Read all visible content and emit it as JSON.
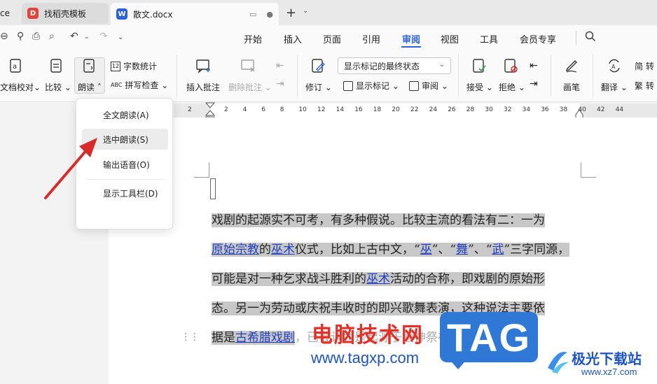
{
  "colors": {
    "accent": "#2b62d9",
    "selection": "#c8c8c8",
    "link": "#1f3fbf",
    "arrow": "#d62c2c"
  },
  "tabs": [
    {
      "label": "ce"
    },
    {
      "label": "找稻壳模板",
      "icon": "docer-icon"
    },
    {
      "label": "散文.docx",
      "icon": "word-doc-icon"
    }
  ],
  "menu": [
    "开始",
    "插入",
    "页面",
    "引用",
    "审阅",
    "视图",
    "工具",
    "会员专享"
  ],
  "menu_active": "审阅",
  "ribbon": {
    "doc_check": "文档校对",
    "compare": "比较",
    "read_aloud": "朗读",
    "word_count": "字数统计",
    "spell_check": "拼写检查",
    "insert_comment": "插入批注",
    "delete_comment": "删除批注",
    "revise": "修订",
    "show_markup_final": "显示标记的最终状态",
    "show_markup": "显示标记",
    "review": "审阅",
    "accept": "接受",
    "reject": "拒绝",
    "pen": "画笔",
    "translate": "翻译",
    "convert_simplified": "简 转",
    "convert_traditional": "繁 转"
  },
  "ruler_ticks": [
    "2",
    "2",
    "4",
    "6",
    "8",
    "10",
    "12",
    "14",
    "16",
    "18",
    "20",
    "22",
    "24",
    "26",
    "28",
    "30",
    "32",
    "34",
    "36",
    "38",
    "40",
    "42",
    "44"
  ],
  "popup": {
    "items": [
      "全文朗读(A)",
      "选中朗读(S)",
      "输出语音(O)",
      "显示工具栏(D)"
    ],
    "hovered_index": 1
  },
  "document": {
    "line1": "戏剧的起源实不可考，有多种假说。比较主流的看法有二：一为",
    "line2_a": "原始宗教",
    "line2_b": "的",
    "line2_c": "巫术",
    "line2_d": "仪式，比如上古中文，“",
    "line2_e": "巫",
    "line2_f": "”、“",
    "line2_g": "舞",
    "line2_h": "”、“",
    "line2_i": "武",
    "line2_j": "”三字同源，",
    "line3_a": "可能是对一种乞求战斗胜利的",
    "line3_b": "巫术",
    "line3_c": "活动的合称，即戏剧的原始形",
    "line4": "态。另一为劳动或庆祝丰收时的即兴歌舞表演，这种说法主要依",
    "line5_a": "据是",
    "line5_b": "古希腊戏剧",
    "line5_c": "，已被认为是起源于酒神祭祀"
  },
  "watermark": {
    "site_name": "电脑技术网",
    "site_url": "www.tagxp.com",
    "tag": "TAG",
    "brand": "极光下载站",
    "brand_url": "www.xz7.com"
  }
}
